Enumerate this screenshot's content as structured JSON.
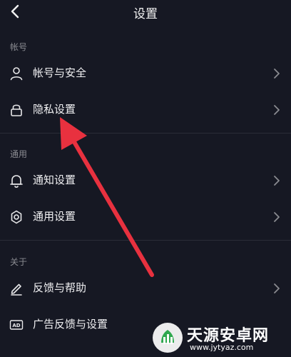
{
  "header": {
    "title": "设置"
  },
  "sections": {
    "account": {
      "label": "帐号",
      "items": [
        {
          "label": "帐号与安全",
          "icon": "user-icon"
        },
        {
          "label": "隐私设置",
          "icon": "lock-icon"
        }
      ]
    },
    "general": {
      "label": "通用",
      "items": [
        {
          "label": "通知设置",
          "icon": "bell-icon"
        },
        {
          "label": "通用设置",
          "icon": "gear-icon"
        }
      ]
    },
    "about": {
      "label": "关于",
      "items": [
        {
          "label": "反馈与帮助",
          "icon": "pencil-icon"
        },
        {
          "label": "广告反馈与设置",
          "icon": "ad-icon"
        }
      ]
    }
  },
  "watermark": {
    "name": "天源安卓网",
    "url": "www.jytyaz.com"
  },
  "colors": {
    "background": "#161823",
    "arrow": "#e8313f",
    "text": "#f0f0f2",
    "muted": "#8a8b91"
  }
}
